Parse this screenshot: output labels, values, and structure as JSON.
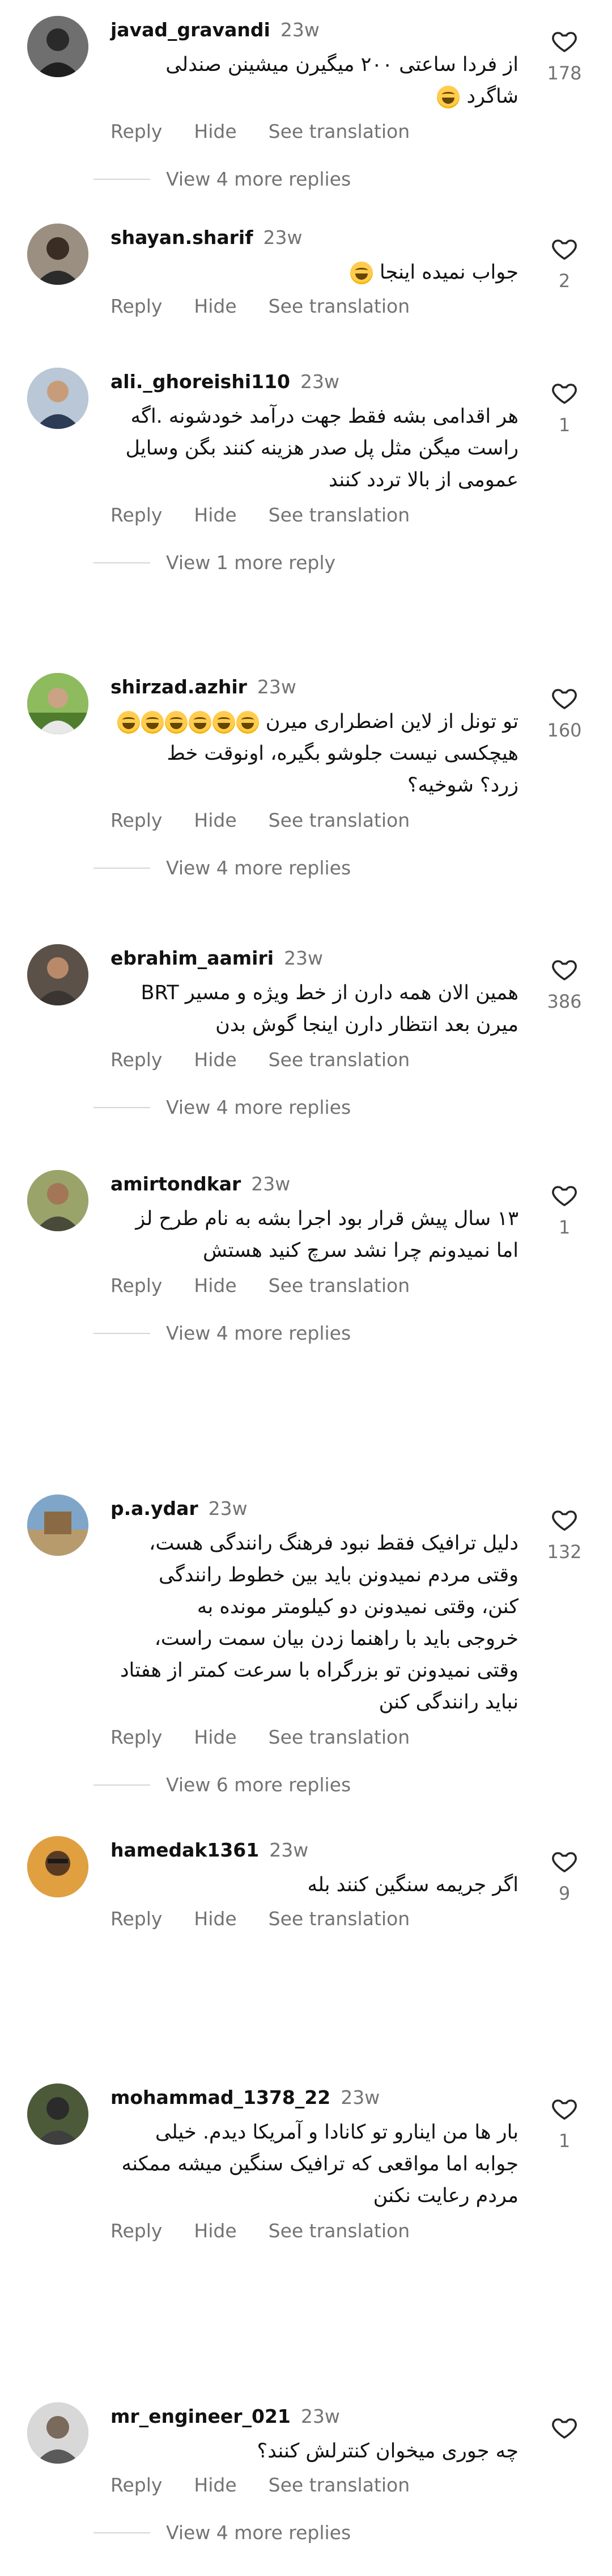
{
  "labels": {
    "reply": "Reply",
    "hide": "Hide",
    "see_translation": "See translation"
  },
  "comments": [
    {
      "username": "javad_gravandi",
      "time": "23w",
      "lines": [
        "از فردا ساعتی ۲۰۰ میگیرن میشینن صندلی",
        "شاگرد"
      ],
      "emoji_line2": 1,
      "likes": "178",
      "replies": "View 4 more replies"
    },
    {
      "username": "shayan.sharif",
      "time": "23w",
      "lines": [
        "جواب نمیده اینجا"
      ],
      "emoji_line1": 1,
      "likes": "2",
      "replies": ""
    },
    {
      "username": "ali._ghoreishi110",
      "time": "23w",
      "lines": [
        "هر اقدامی بشه فقط جهت درآمد خودشونه .اگه",
        "راست میگن مثل پل صدر هزینه کنند بگن وسایل",
        "عمومی از بالا تردد کنند"
      ],
      "likes": "1",
      "replies": "View 1 more reply"
    },
    {
      "username": "shirzad.azhir",
      "time": "23w",
      "lines": [
        "تو تونل از لاین اضطراری میرن",
        "هیچکسی نیست جلوشو بگیره، اونوقت خط",
        "زرد؟ شوخیه؟"
      ],
      "emoji_line1": 6,
      "likes": "160",
      "replies": "View 4 more replies"
    },
    {
      "username": "ebrahim_aamiri",
      "time": "23w",
      "lines": [
        "همین الان همه دارن از خط ویژه و مسیر BRT",
        "میرن بعد انتظار دارن اینجا گوش بدن"
      ],
      "likes": "386",
      "replies": "View 4 more replies"
    },
    {
      "username": "amirtondkar",
      "time": "23w",
      "lines": [
        "۱۳ سال پیش قرار بود اجرا بشه به نام طرح لز",
        "اما نمیدونم چرا نشد سرچ کنید هستش"
      ],
      "likes": "1",
      "replies": "View 4 more replies"
    },
    {
      "username": "p.a.ydar",
      "time": "23w",
      "lines": [
        "دلیل ترافیک فقط نبود فرهنگ رانندگی هست،",
        "وقتی مردم نمیدونن باید بین خطوط رانندگی",
        "کنن، وقتی نمیدونن دو کیلومتر مونده به",
        "خروجی باید با راهنما زدن بیان سمت راست،",
        "وقتی نمیدونن تو بزرگراه با سرعت کمتر از هفتاد",
        "نباید رانندگی کنن"
      ],
      "likes": "132",
      "replies": "View 6 more replies"
    },
    {
      "username": "hamedak1361",
      "time": "23w",
      "lines": [
        "اگر جریمه سنگین کنند بله"
      ],
      "likes": "9",
      "replies": ""
    },
    {
      "username": "mohammad_1378_22",
      "time": "23w",
      "lines": [
        "بار ها من اینارو تو کانادا و آمریکا دیدم. خیلی",
        "جوابه اما مواقعی که ترافیک سنگین میشه ممکنه",
        "مردم رعایت نکنن"
      ],
      "likes": "1",
      "replies": ""
    },
    {
      "username": "mr_engineer_021",
      "time": "23w",
      "lines": [
        "چه جوری میخوان کنترلش کنند؟"
      ],
      "likes": "",
      "replies": "View 4 more replies"
    }
  ]
}
